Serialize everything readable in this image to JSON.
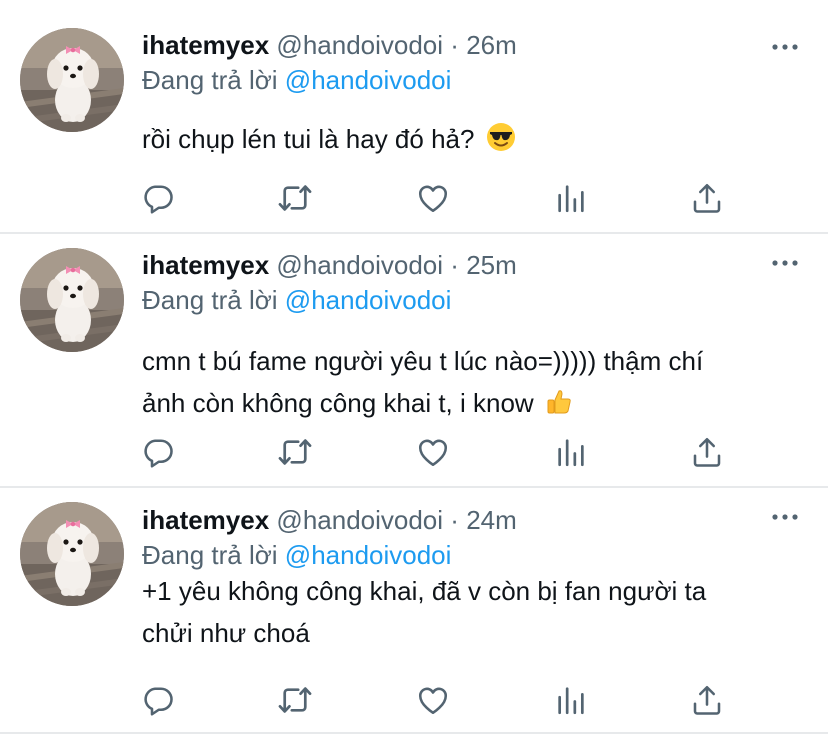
{
  "tweets": [
    {
      "name": "ihatemyex",
      "handle": "@handoivodoi",
      "separator": "·",
      "time": "26m",
      "reply_prefix": "Đang trả lời",
      "reply_to": "@handoivodoi",
      "lines": [
        "rồi chụp lén tui là hay đó hả?"
      ],
      "emoji": "smiling-face-with-sunglasses"
    },
    {
      "name": "ihatemyex",
      "handle": "@handoivodoi",
      "separator": "·",
      "time": "25m",
      "reply_prefix": "Đang trả lời",
      "reply_to": "@handoivodoi",
      "lines": [
        "cmn t bú fame người yêu t lúc nào=))))) thậm chí",
        "ảnh còn không công khai t, i know"
      ],
      "emoji": "thumbs-up"
    },
    {
      "name": "ihatemyex",
      "handle": "@handoivodoi",
      "separator": "·",
      "time": "24m",
      "reply_prefix": "Đang trả lời",
      "reply_to": "@handoivodoi",
      "lines": [
        "+1 yêu không công khai, đã v còn bị fan người ta",
        "chửi như choá"
      ]
    }
  ],
  "icons": [
    "more-icon",
    "reply-icon",
    "retweet-icon",
    "like-icon",
    "stats-icon",
    "share-icon"
  ],
  "colors": {
    "link": "#1d9bf0",
    "secondary": "#536471",
    "text": "#0f1419",
    "divider": "#e7e9eb"
  }
}
